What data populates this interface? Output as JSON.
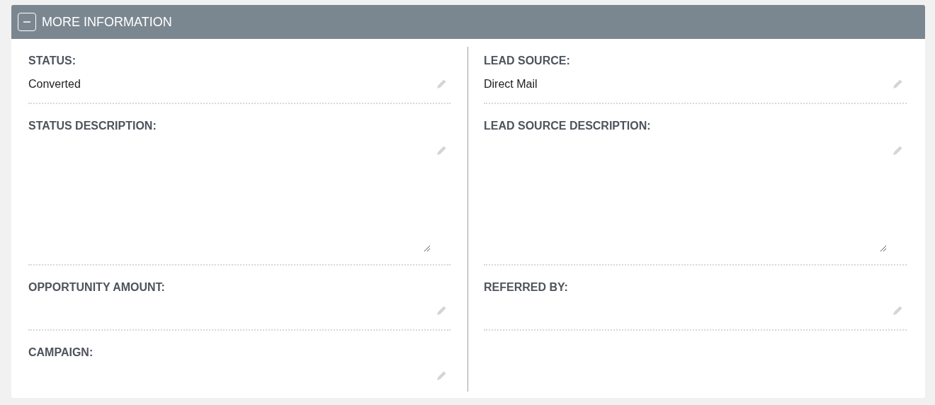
{
  "panel": {
    "title": "MORE INFORMATION",
    "expanded": true
  },
  "columns": [
    {
      "fields": [
        {
          "kind": "text",
          "label": "STATUS:",
          "value": "Converted"
        },
        {
          "kind": "textarea",
          "label": "STATUS DESCRIPTION:"
        },
        {
          "kind": "text",
          "label": "OPPORTUNITY AMOUNT:"
        },
        {
          "kind": "text",
          "label": "CAMPAIGN:"
        }
      ]
    },
    {
      "fields": [
        {
          "kind": "text",
          "label": "LEAD SOURCE:",
          "value": "Direct Mail"
        },
        {
          "kind": "textarea",
          "label": "LEAD SOURCE DESCRIPTION:"
        },
        {
          "kind": "text",
          "label": "REFERRED BY:"
        }
      ]
    }
  ]
}
